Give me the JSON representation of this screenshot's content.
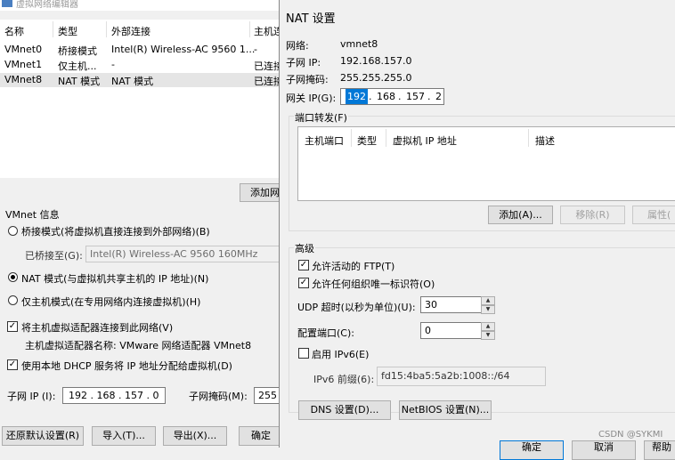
{
  "main": {
    "title": "虚拟网络编辑器",
    "columns": [
      "名称",
      "类型",
      "外部连接",
      "主机连"
    ],
    "rows": [
      [
        "VMnet0",
        "桥接模式",
        "Intel(R) Wireless-AC 9560 1...",
        "-"
      ],
      [
        "VMnet1",
        "仅主机...",
        "-",
        "已连接"
      ],
      [
        "VMnet8",
        "NAT 模式",
        "NAT 模式",
        "已连接"
      ]
    ],
    "add_network_button": "添加网",
    "vmnet_info_label": "VMnet 信息",
    "bridge_radio": "桥接模式(将虚拟机直接连接到外部网络)(B)",
    "bridged_to_label": "已桥接至(G):",
    "bridged_to_value": "Intel(R) Wireless-AC 9560 160MHz",
    "nat_radio": "NAT 模式(与虚拟机共享主机的 IP 地址)(N)",
    "host_only_radio": "仅主机模式(在专用网络内连接虚拟机)(H)",
    "connect_adapter_check": "将主机虚拟适配器连接到此网络(V)",
    "adapter_name_text": "主机虚拟适配器名称: VMware 网络适配器 VMnet8",
    "dhcp_check": "使用本地 DHCP 服务将 IP 地址分配给虚拟机(D)",
    "subnet_ip_label": "子网 IP (I):",
    "subnet_ip_value": "192 . 168 . 157 .  0",
    "subnet_mask_label": "子网掩码(M):",
    "subnet_mask_value": "255",
    "restore_button": "还原默认设置(R)",
    "import_button": "导入(T)...",
    "export_button": "导出(X)...",
    "ok_button": "确定"
  },
  "nat": {
    "title": "NAT 设置",
    "network_label": "网络:",
    "network_value": "vmnet8",
    "subnet_ip_label": "子网 IP:",
    "subnet_ip_value": "192.168.157.0",
    "subnet_mask_label": "子网掩码:",
    "subnet_mask_value": "255.255.255.0",
    "gateway_label": "网关 IP(G):",
    "gateway_octets": [
      "192",
      "168",
      "157",
      "2"
    ],
    "port_forward_label": "端口转发(F)",
    "pf_columns": [
      "主机端口",
      "类型",
      "虚拟机 IP 地址",
      "描述"
    ],
    "add_button": "添加(A)...",
    "remove_button": "移除(R)",
    "props_button": "属性(",
    "advanced_label": "高级",
    "allow_ftp": "允许活动的 FTP(T)",
    "allow_uid": "允许任何组织唯一标识符(O)",
    "udp_label": "UDP 超时(以秒为单位)(U):",
    "udp_value": "30",
    "config_port_label": "配置端口(C):",
    "config_port_value": "0",
    "ipv6_check": "启用 IPv6(E)",
    "ipv6_prefix_label": "IPv6 前缀(6):",
    "ipv6_prefix_value": "fd15:4ba5:5a2b:1008::/64",
    "dns_button": "DNS 设置(D)...",
    "netbios_button": "NetBIOS 设置(N)...",
    "bottom_ok": "确定",
    "bottom_cancel": "取消",
    "bottom_help": "帮助"
  },
  "watermark": "CSDN @SYKMI"
}
